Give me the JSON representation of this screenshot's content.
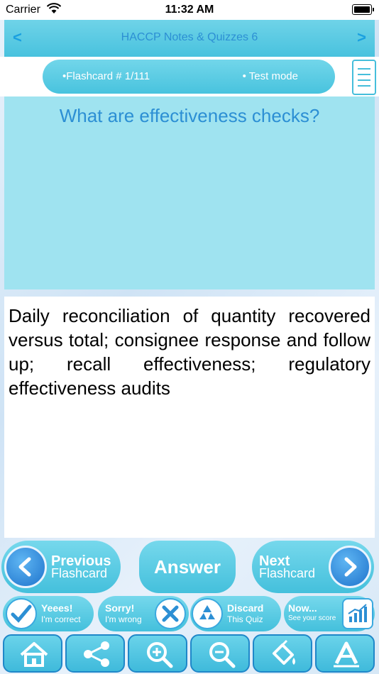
{
  "status_bar": {
    "carrier": "Carrier",
    "time": "11:32 AM"
  },
  "nav": {
    "back": "<",
    "forward": ">",
    "title": "HACCP Notes & Quizzes 6"
  },
  "info": {
    "flashcard": "•Flashcard #  1/111",
    "mode": "• Test mode"
  },
  "question": "What are effectiveness checks?",
  "answer": "Daily reconciliation of quantity recovered versus total; consignee response and follow up; recall effectiveness; regulatory effectiveness audits",
  "buttons": {
    "previous": {
      "line1": "Previous",
      "line2": "Flashcard"
    },
    "answer": "Answer",
    "next": {
      "line1": "Next",
      "line2": "Flashcard"
    }
  },
  "scoring": [
    {
      "line1": "Yeees!",
      "line2": "I'm correct",
      "icon": "check-icon"
    },
    {
      "line1": "Sorry!",
      "line2": "I'm wrong",
      "icon": "x-icon"
    },
    {
      "line1": "Discard",
      "line2": "This Quiz",
      "icon": "recycle-icon"
    },
    {
      "line1": "Now...",
      "line2": "See your score",
      "icon": "chart-icon"
    }
  ],
  "toolbar": [
    "home-icon",
    "share-icon",
    "zoom-in-icon",
    "zoom-out-icon",
    "paint-bucket-icon",
    "font-icon"
  ],
  "colors": {
    "accent": "#48c2de",
    "title_blue": "#2c8fd4",
    "circle_blue": "#1e73cc"
  }
}
